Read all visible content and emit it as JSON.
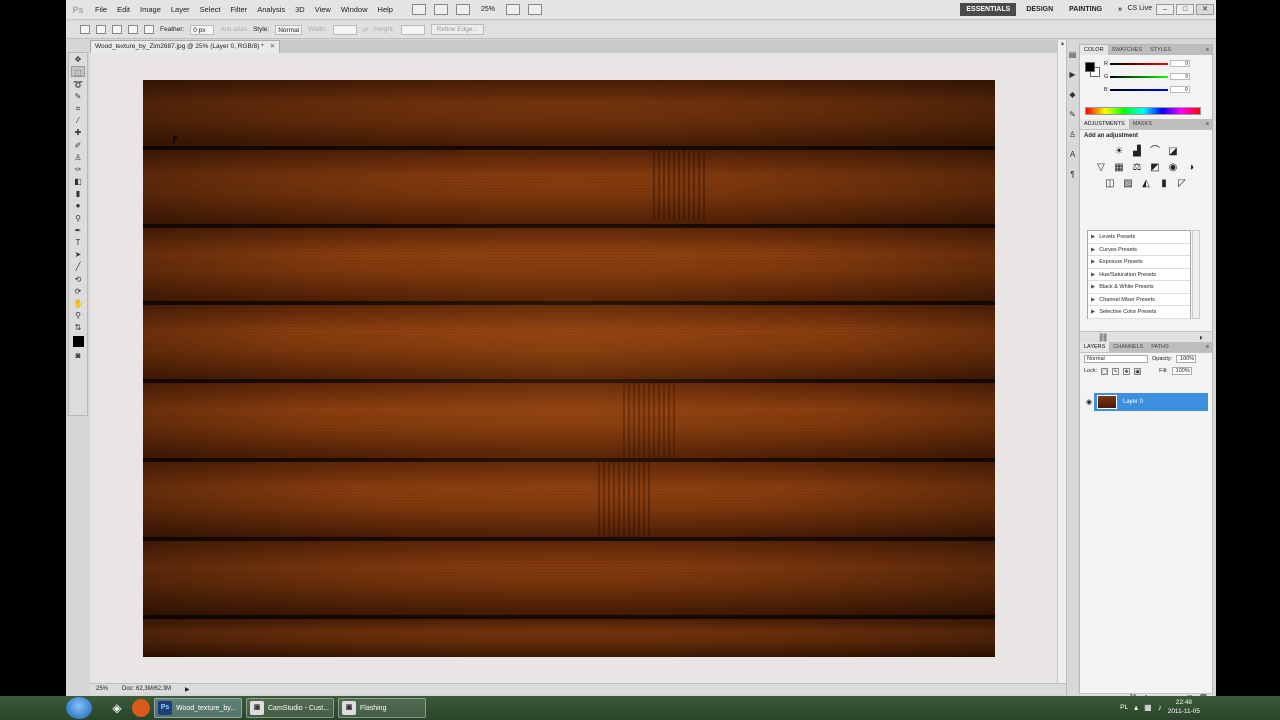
{
  "app": {
    "logo": "Ps",
    "menu": [
      "File",
      "Edit",
      "Image",
      "Layer",
      "Select",
      "Filter",
      "Analysis",
      "3D",
      "View",
      "Window",
      "Help"
    ],
    "zoom": "25%",
    "workspaces": [
      "ESSENTIALS",
      "DESIGN",
      "PAINTING"
    ],
    "overflow": "»",
    "cslive": "CS Live",
    "window_controls": [
      "–",
      "□",
      "✕"
    ]
  },
  "options": {
    "feather_label": "Feather:",
    "feather_value": "0 px",
    "antialias": "Anti-alias",
    "style_label": "Style:",
    "style_value": "Normal",
    "width_label": "Width:",
    "height_label": "Height:",
    "refine": "Refine Edge..."
  },
  "document": {
    "tab_title": "Wood_texture_by_Zim2687.jpg @ 25% (Layer 0, RGB/8) *",
    "tab_close": "✕",
    "status_zoom": "25%",
    "status_doc": "Doc: 62,3M/62,3M"
  },
  "panels": {
    "color_tabs": [
      "COLOR",
      "SWATCHES",
      "STYLES"
    ],
    "color_channels": [
      {
        "label": "R",
        "value": "0"
      },
      {
        "label": "G",
        "value": "0"
      },
      {
        "label": "B",
        "value": "0"
      }
    ],
    "adj_tabs": [
      "ADJUSTMENTS",
      "MASKS"
    ],
    "adj_title": "Add an adjustment",
    "presets": [
      "Levels Presets",
      "Curves Presets",
      "Exposure Presets",
      "Hue/Saturation Presets",
      "Black & White Presets",
      "Channel Mixer Presets",
      "Selective Color Presets"
    ],
    "layer_tabs": [
      "LAYERS",
      "CHANNELS",
      "PATHS"
    ],
    "blend_mode": "Normal",
    "opacity_label": "Opacity:",
    "opacity_value": "100%",
    "lock_label": "Lock:",
    "fill_label": "Fill:",
    "fill_value": "100%",
    "layer_name": "Layer 0"
  },
  "taskbar": {
    "tasks": [
      {
        "icon": "Ps",
        "label": "Wood_texture_by..."
      },
      {
        "icon": "▣",
        "label": "CamStudio - Cust..."
      },
      {
        "icon": "▣",
        "label": "Flashing"
      }
    ],
    "lang": "PL",
    "time": "22:48",
    "date": "2011-11-05"
  }
}
